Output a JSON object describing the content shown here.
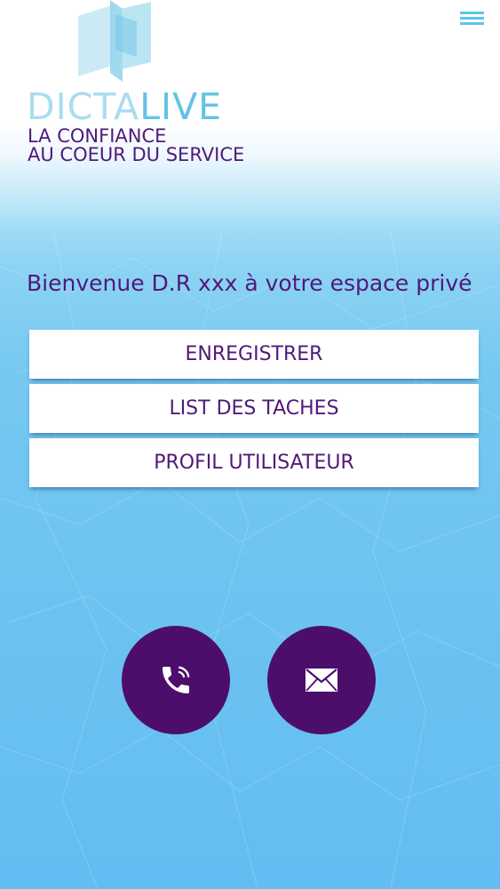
{
  "brand": {
    "name_part_a": "DICTA",
    "name_part_b": "LIVE",
    "tagline_line1": "LA CONFIANCE",
    "tagline_line2": "AU COEUR DU SERVICE"
  },
  "header": {
    "menu_icon": "hamburger-menu-icon"
  },
  "welcome_text": "Bienvenue D.R xxx à votre  espace privé",
  "menu": [
    {
      "label": "ENREGISTRER"
    },
    {
      "label": "LIST DES TACHES"
    },
    {
      "label": "PROFIL UTILISATEUR"
    }
  ],
  "contact": {
    "phone_icon": "phone-icon",
    "mail_icon": "envelope-icon"
  },
  "colors": {
    "primary_purple": "#50197a",
    "button_purple": "#4d0e6b",
    "accent_blue": "#62c3e6",
    "light_blue": "#a9dcef",
    "background_blue": "#6cc2f1"
  }
}
